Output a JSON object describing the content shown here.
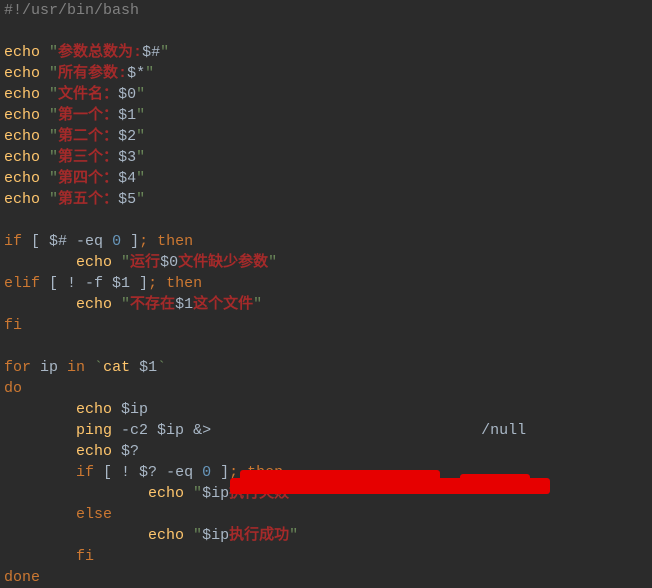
{
  "code": {
    "l01": {
      "shebang": "#!/usr/bin/bash"
    },
    "l03": {
      "cmd": "echo",
      "q": "\"",
      "red": "参数总数为:",
      "var": "$#",
      "q2": "\""
    },
    "l04": {
      "cmd": "echo",
      "q": "\"",
      "red": "所有参数:",
      "var": "$*",
      "q2": "\""
    },
    "l05": {
      "cmd": "echo",
      "q": "\"",
      "red": "文件名：",
      "var": "$0",
      "q2": "\""
    },
    "l06": {
      "cmd": "echo",
      "q": "\"",
      "red": "第一个：",
      "var": "$1",
      "q2": "\""
    },
    "l07": {
      "cmd": "echo",
      "q": "\"",
      "red": "第二个：",
      "var": "$2",
      "q2": "\""
    },
    "l08": {
      "cmd": "echo",
      "q": "\"",
      "red": "第三个：",
      "var": "$3",
      "q2": "\""
    },
    "l09": {
      "cmd": "echo",
      "q": "\"",
      "red": "第四个：",
      "var": "$4",
      "q2": "\""
    },
    "l10": {
      "cmd": "echo",
      "q": "\"",
      "red": "第五个：",
      "var": "$5",
      "q2": "\""
    },
    "l12": {
      "kw1": "if ",
      "br": "[ ",
      "var": "$#",
      "op": " -eq ",
      "num": "0",
      "br2": " ]",
      "kw2": "; then"
    },
    "l13": {
      "indent": "        ",
      "cmd": "echo",
      "q": " \"",
      "red": "运行",
      "var": "$0",
      "red2": "文件缺少参数",
      "q2": "\""
    },
    "l14": {
      "kw1": "elif ",
      "br": "[ ! -f ",
      "var": "$1",
      "br2": " ]",
      "kw2": "; then"
    },
    "l15": {
      "indent": "        ",
      "cmd": "echo",
      "q": " \"",
      "red": "不存在",
      "var": "$1",
      "red2": "这个文件",
      "q2": "\""
    },
    "l16": {
      "kw": "fi"
    },
    "l18": {
      "kw": "for ",
      "var": "ip",
      "kw2": " in ",
      "bt": "`",
      "cmd": "cat ",
      "arg": "$1",
      "bt2": "`"
    },
    "l19": {
      "kw": "do"
    },
    "l20": {
      "indent": "        ",
      "cmd": "echo ",
      "var": "$ip"
    },
    "l21": {
      "indent": "        ",
      "cmd": "ping",
      "args": " -c2 ",
      "var": "$ip",
      "redir": " &> ",
      "hidden": "                             ",
      "tail": "/null"
    },
    "l22": {
      "indent": "        ",
      "cmd": "echo ",
      "var": "$?"
    },
    "l23": {
      "indent": "        ",
      "kw1": "if ",
      "br": "[ ! ",
      "var": "$?",
      "op": " -eq ",
      "num": "0",
      "br2": " ]",
      "kw2": "; then"
    },
    "l24": {
      "indent": "                ",
      "cmd": "echo",
      "q": " \"",
      "var": "$ip",
      "red": "执行失败",
      "q2": "\""
    },
    "l25": {
      "indent": "        ",
      "kw": "else"
    },
    "l26": {
      "indent": "                ",
      "cmd": "echo",
      "q": " \"",
      "var": "$ip",
      "red": "执行成功",
      "q2": "\""
    },
    "l27": {
      "indent": "        ",
      "kw": "fi"
    },
    "l28": {
      "kw": "done"
    }
  }
}
